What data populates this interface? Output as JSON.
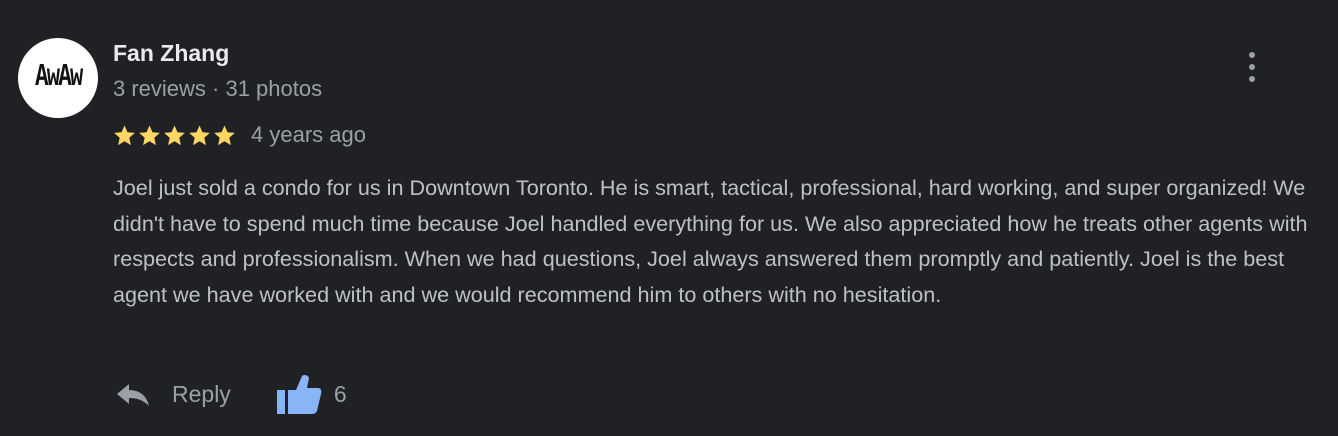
{
  "review": {
    "avatar": {
      "text": "AwAw",
      "icon": "profile-avatar"
    },
    "author": {
      "name": "Fan Zhang",
      "meta": "3 reviews · 31 photos"
    },
    "rating": {
      "stars": 5,
      "max_stars": 5,
      "star_color": "#fdd663",
      "time": "4 years ago"
    },
    "text": "Joel just sold a condo for us in Downtown Toronto. He is smart, tactical, professional, hard working, and super organized! We didn't have to spend much time because Joel handled everything for us. We also appreciated how he treats other agents with respects and professionalism. When we had questions, Joel always answered them promptly and patiently. Joel is the best agent we have worked with and we would recommend him to others with no hesitation.",
    "actions": {
      "more_icon": "more-vert-icon",
      "reply_icon": "reply-icon",
      "reply_label": "Reply",
      "like_icon": "thumbs-up-icon",
      "like_count": "6",
      "like_color": "#8ab4f8"
    }
  }
}
